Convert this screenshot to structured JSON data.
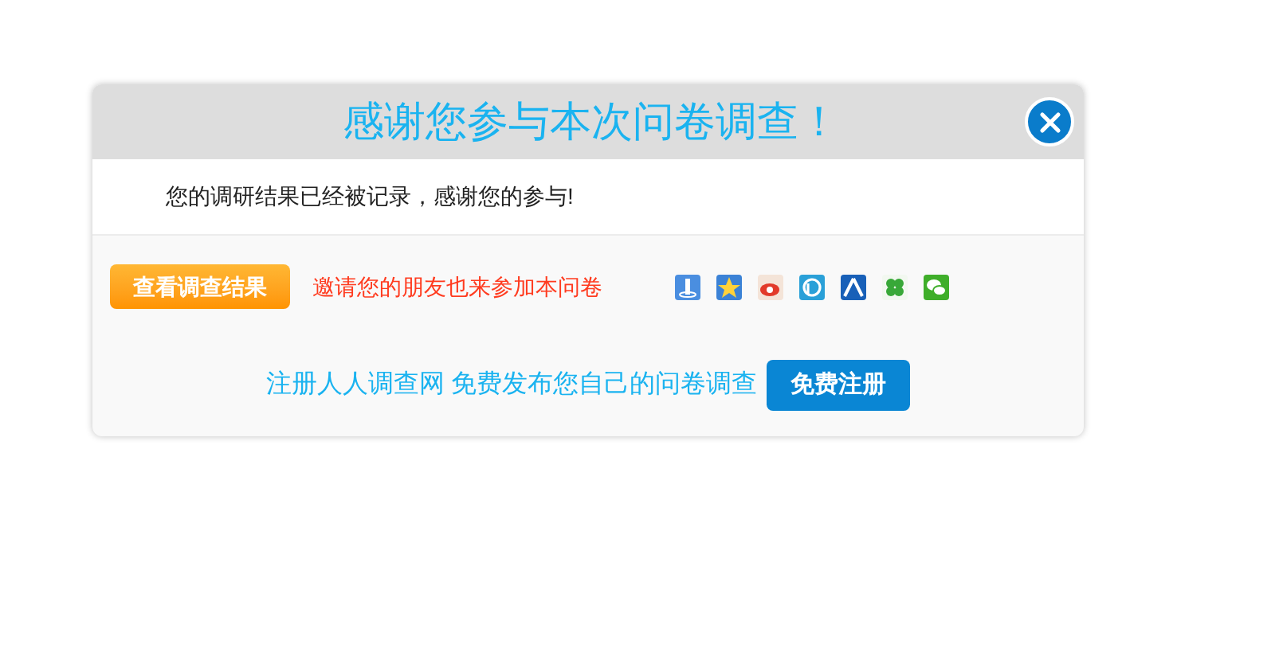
{
  "dialog": {
    "title": "感谢您参与本次问卷调查！",
    "message": "您的调研结果已经被记录，感谢您的参与!",
    "result_button": "查看调查结果",
    "invite_text": "邀请您的朋友也来参加本问卷",
    "promo_text": "注册人人调查网 免费发布您自己的问卷调查",
    "register_button": "免费注册"
  }
}
